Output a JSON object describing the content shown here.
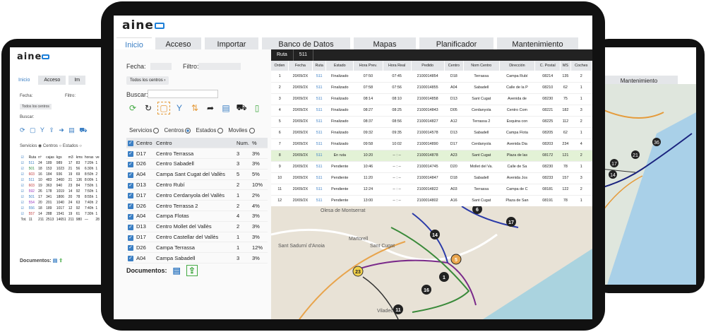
{
  "brand": "aine",
  "tabs": [
    "Inicio",
    "Acceso",
    "Importar",
    "Banco de Datos",
    "Mapas",
    "Planificador",
    "Mantenimiento"
  ],
  "left_panel": {
    "fecha_label": "Fecha:",
    "filtro_label": "Filtro:",
    "centros_btn": "Todos los centros",
    "buscar_label": "Buscar:",
    "radio_servicios": "Servicios",
    "radio_centros": "Centros",
    "radio_estados": "Estados",
    "radio_moviles": "Moviles",
    "headers": [
      "Centro",
      "Centro",
      "Num.",
      "%"
    ],
    "rows": [
      [
        "D17",
        "Centro Terrassa",
        "3",
        "3%"
      ],
      [
        "D26",
        "Centro Sabadell",
        "3",
        "3%"
      ],
      [
        "A04",
        "Campa Sant Cugat del Vallès",
        "5",
        "5%"
      ],
      [
        "D13",
        "Centro Rubí",
        "2",
        "10%"
      ],
      [
        "D17",
        "Centro Cerdanyola del Vallès",
        "1",
        "2%"
      ],
      [
        "D26",
        "Centro Terrassa 2",
        "2",
        "4%"
      ],
      [
        "A04",
        "Campa Flotas",
        "4",
        "3%"
      ],
      [
        "D13",
        "Centro Mollet del Vallès",
        "2",
        "3%"
      ],
      [
        "D17",
        "Centro Castellar del Vallès",
        "1",
        "3%"
      ],
      [
        "D26",
        "Campa Terrassa",
        "1",
        "12%"
      ],
      [
        "A04",
        "Campa Sabadell",
        "3",
        "3%"
      ]
    ],
    "documentos": "Documentos:"
  },
  "grid": {
    "tab_ruta": "Ruta",
    "tab_id": "511",
    "headers": [
      "Orden",
      "Fecha",
      "Ruta",
      "Estado",
      "Hora Prev.",
      "Hora Real",
      "Pedido",
      "Centro",
      "Nom Centro",
      "Dirección",
      "C. Postal",
      "MS",
      "Coches"
    ],
    "rows": [
      [
        "1",
        "20/09/2X",
        "511",
        "Finalizado",
        "07:50",
        "07:45",
        "2100014854",
        "D18",
        "Terrassa",
        "Campa Rubí",
        "08214",
        "135",
        "2"
      ],
      [
        "2",
        "20/09/2X",
        "511",
        "Finalizado",
        "07:58",
        "07:56",
        "2100014855",
        "A04",
        "Sabadell",
        "Calle de la P",
        "08210",
        "62",
        "1"
      ],
      [
        "3",
        "20/09/2X",
        "511",
        "Finalizado",
        "08:14",
        "08:10",
        "2100014858",
        "D13",
        "Sant Cugat",
        "Avenida de",
        "08230",
        "75",
        "1"
      ],
      [
        "4",
        "20/09/2X",
        "511",
        "Finalizado",
        "08:27",
        "08:25",
        "2100014843",
        "D05",
        "Cerdanyola",
        "Centro Com",
        "08221",
        "182",
        "3"
      ],
      [
        "5",
        "20/09/2X",
        "511",
        "Finalizado",
        "08:37",
        "08:56",
        "2100014827",
        "A12",
        "Terrassa 2",
        "Esquina con",
        "08225",
        "112",
        "2"
      ],
      [
        "6",
        "20/09/2X",
        "511",
        "Finalizado",
        "09:32",
        "09:35",
        "2100014578",
        "D13",
        "Sabadell",
        "Campa Flota",
        "08205",
        "62",
        "1"
      ],
      [
        "7",
        "20/09/2X",
        "511",
        "Finalizado",
        "09:58",
        "10:02",
        "2100014890",
        "D17",
        "Cerdanyola",
        "Avenida Dia",
        "08203",
        "234",
        "4"
      ],
      [
        "8",
        "20/09/2X",
        "511",
        "En ruta",
        "10:20",
        "-- : --",
        "2100014878",
        "A23",
        "Sant Cugat",
        "Plaza de las",
        "08172",
        "121",
        "2"
      ],
      [
        "9",
        "20/09/2X",
        "511",
        "Pendiente",
        "10:46",
        "-- : --",
        "2100014745",
        "D20",
        "Mollet del Va.",
        "Calle de Sa",
        "08230",
        "78",
        "1"
      ],
      [
        "10",
        "20/09/2X",
        "511",
        "Pendiente",
        "11:20",
        "-- : --",
        "2100014847",
        "D18",
        "Sabadell",
        "Avenida Jos",
        "08233",
        "157",
        "3"
      ],
      [
        "11",
        "20/09/2X",
        "511",
        "Pendiente",
        "12:24",
        "-- : --",
        "2100014822",
        "A03",
        "Terrassa",
        "Campa de C",
        "08181",
        "122",
        "2"
      ],
      [
        "12",
        "20/09/2X",
        "511",
        "Pendiente",
        "13:00",
        "-- : --",
        "2100014802",
        "A16",
        "Sant Cugat",
        "Plaza de San",
        "08191",
        "78",
        "1"
      ]
    ]
  },
  "map": {
    "labels": [
      "Olesa de Montserrat",
      "Sant Sadurní d'Anoia",
      "Viladecans",
      "Sant Cugat",
      "Martorell"
    ],
    "markers": [
      "23",
      "6",
      "17",
      "14",
      "11",
      "5",
      "16",
      "1"
    ]
  },
  "left_device": {
    "tabs": [
      "Inicio",
      "Acceso",
      "Im"
    ],
    "fecha": "Fecha:",
    "filtro": "Filtro:",
    "centros": "Todos los centros",
    "buscar": "Buscar:",
    "radios": [
      "Servicios",
      "Centros",
      "Estados"
    ],
    "headers": [
      "Ruta",
      "nº",
      "cajas",
      "kgs",
      "m3",
      "kms",
      "horas",
      "ve"
    ],
    "rows": [
      [
        "511",
        "24",
        "189",
        "989",
        "17",
        "83",
        "7:20h",
        "1"
      ],
      [
        "501",
        "18",
        "153",
        "1023",
        "21",
        "56",
        "6:30h",
        "1"
      ],
      [
        "603",
        "16",
        "184",
        "936",
        "19",
        "69",
        "8:50h",
        "2"
      ],
      [
        "511",
        "10",
        "483",
        "3460",
        "21",
        "136",
        "8:00h",
        "1"
      ],
      [
        "603",
        "19",
        "363",
        "940",
        "23",
        "84",
        "7:50h",
        "1"
      ],
      [
        "592",
        "26",
        "178",
        "1019",
        "14",
        "92",
        "7:50h",
        "1"
      ],
      [
        "501",
        "17",
        "341",
        "1806",
        "20",
        "78",
        "8:55h",
        "1"
      ],
      [
        "554",
        "20",
        "201",
        "1040",
        "24",
        "63",
        "7:40h",
        "2"
      ],
      [
        "556",
        "18",
        "189",
        "1017",
        "12",
        "92",
        "7:40h",
        "1"
      ],
      [
        "557",
        "14",
        "288",
        "1541",
        "19",
        "61",
        "7:30h",
        "1"
      ]
    ],
    "total": [
      "Tot.",
      "11",
      "211",
      "2513",
      "14651",
      "211",
      "980",
      "—",
      "28"
    ],
    "documentos": "Documentos:"
  },
  "right_device": {
    "tab": "Mantenimiento",
    "markers": [
      "17",
      "21",
      "36",
      "14"
    ]
  }
}
